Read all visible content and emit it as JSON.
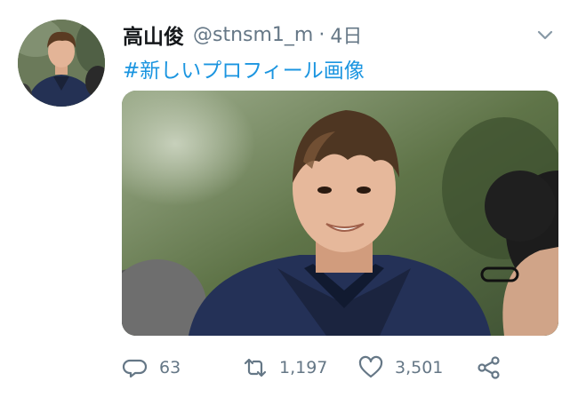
{
  "tweet": {
    "display_name": "高山俊",
    "handle": "@stnsm1_m",
    "separator": "·",
    "time": "4日",
    "hashtag": "#新しいプロフィール画像",
    "icons": {
      "menu": "chevron-down-icon",
      "reply": "reply-icon",
      "retweet": "retweet-icon",
      "like": "heart-icon",
      "share": "share-icon"
    },
    "stats": {
      "replies": "63",
      "retweets": "1,197",
      "likes": "3,501"
    },
    "colors": {
      "hashtag": "#1b95e0",
      "muted": "#657786",
      "text": "#14171a"
    }
  }
}
